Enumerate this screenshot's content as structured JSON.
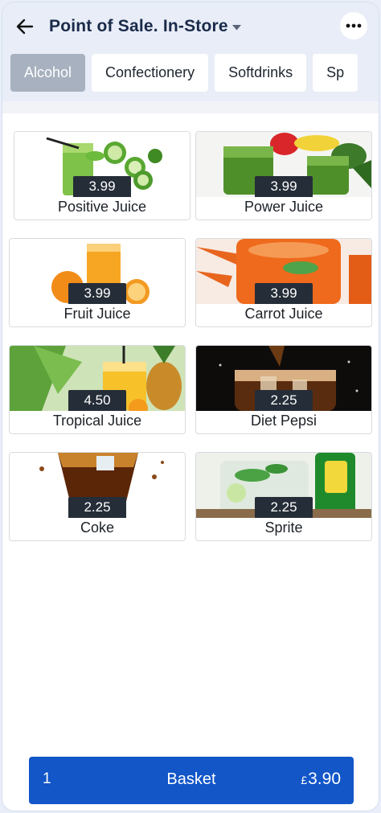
{
  "header": {
    "title": "Point of Sale. In-Store",
    "back_icon": "arrow-left-icon",
    "dropdown_icon": "caret-down-icon",
    "more_icon": "more-horizontal-icon"
  },
  "tabs": [
    {
      "label": "Alcohol",
      "active": true
    },
    {
      "label": "Confectionery",
      "active": false
    },
    {
      "label": "Softdrinks",
      "active": false
    },
    {
      "label": "Sp",
      "active": false
    }
  ],
  "products": [
    {
      "name": "Positive Juice",
      "price": "3.99"
    },
    {
      "name": "Power Juice",
      "price": "3.99"
    },
    {
      "name": "Fruit Juice",
      "price": "3.99"
    },
    {
      "name": "Carrot Juice",
      "price": "3.99"
    },
    {
      "name": "Tropical Juice",
      "price": "4.50"
    },
    {
      "name": "Diet Pepsi",
      "price": "2.25"
    },
    {
      "name": "Coke",
      "price": "2.25"
    },
    {
      "name": "Sprite",
      "price": "2.25"
    }
  ],
  "basket": {
    "count": "1",
    "label": "Basket",
    "currency": "£",
    "total": "3.90"
  },
  "colors": {
    "accent": "#1256c8",
    "active_tab": "#a7b1bf",
    "price_badge": "#252d38",
    "title": "#1a2a49"
  }
}
